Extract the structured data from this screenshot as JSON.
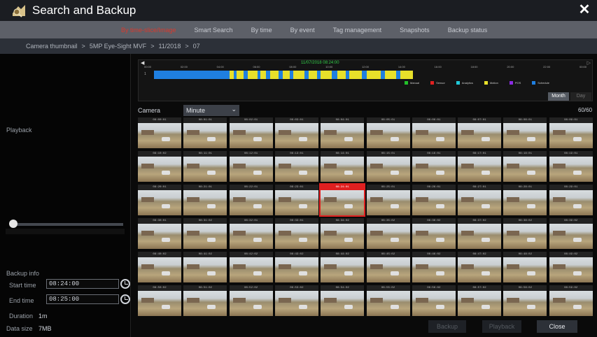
{
  "title": "Search and Backup",
  "tabs": [
    {
      "label": "By time-slice/Image",
      "active": true
    },
    {
      "label": "Smart Search",
      "active": false
    },
    {
      "label": "By time",
      "active": false
    },
    {
      "label": "By event",
      "active": false
    },
    {
      "label": "Tag management",
      "active": false
    },
    {
      "label": "Snapshots",
      "active": false
    },
    {
      "label": "Backup status",
      "active": false
    }
  ],
  "breadcrumb": [
    "Camera thumbnail",
    "5MP Eye-Sight MVF",
    "11/2018",
    "07"
  ],
  "left": {
    "playback_label": "Playback",
    "backup_info": {
      "title": "Backup info",
      "start_time_label": "Start time",
      "start_time": "08:24:00",
      "end_time_label": "End time",
      "end_time": "08:25:00",
      "duration_label": "Duration",
      "duration": "1m",
      "data_size_label": "Data size",
      "data_size": "7MB"
    }
  },
  "timeline": {
    "date": "11/07/2018 08:24:00",
    "ticks": [
      "00:00",
      "02:00",
      "04:00",
      "06:00",
      "08:00",
      "10:00",
      "12:00",
      "14:00",
      "16:00",
      "18:00",
      "20:00",
      "22:00",
      "00:00"
    ],
    "row_label": "1",
    "legend": [
      {
        "label": "Manual",
        "color": "#22c02a"
      },
      {
        "label": "Sensor",
        "color": "#e02020"
      },
      {
        "label": "Analytics",
        "color": "#20c8d8"
      },
      {
        "label": "Motion",
        "color": "#e8e02a"
      },
      {
        "label": "POS",
        "color": "#8a2be2"
      },
      {
        "label": "Schedule",
        "color": "#1f7fe0"
      }
    ],
    "mode_month": "Month",
    "mode_day": "Day"
  },
  "camera_label": "Camera",
  "unit_select": "Minute",
  "count": "60/60",
  "thumbnails": [
    "08:00:01",
    "08:01:01",
    "08:02:01",
    "08:03:01",
    "08:04:01",
    "08:05:01",
    "08:06:01",
    "08:07:01",
    "08:08:01",
    "08:09:01",
    "08:10:02",
    "08:11:01",
    "08:12:01",
    "08:13:01",
    "08:14:01",
    "08:15:01",
    "08:16:01",
    "08:17:01",
    "08:18:01",
    "08:19:01",
    "08:20:01",
    "08:21:01",
    "08:22:01",
    "08:23:01",
    "08:24:01",
    "08:25:01",
    "08:26:01",
    "08:27:01",
    "08:28:01",
    "08:29:01",
    "08:30:01",
    "08:31:02",
    "08:32:01",
    "08:33:01",
    "08:34:02",
    "08:35:02",
    "08:36:02",
    "08:37:02",
    "08:38:02",
    "08:39:02",
    "08:40:02",
    "08:41:02",
    "08:42:02",
    "08:43:02",
    "08:44:02",
    "08:45:02",
    "08:46:02",
    "08:47:02",
    "08:48:02",
    "08:49:02",
    "08:50:02",
    "08:51:02",
    "08:52:02",
    "08:53:02",
    "08:54:02",
    "08:55:02",
    "08:56:02",
    "08:57:02",
    "08:58:02",
    "08:59:02"
  ],
  "selected_index": 24,
  "buttons": {
    "backup": "Backup",
    "playback": "Playback",
    "close": "Close"
  }
}
